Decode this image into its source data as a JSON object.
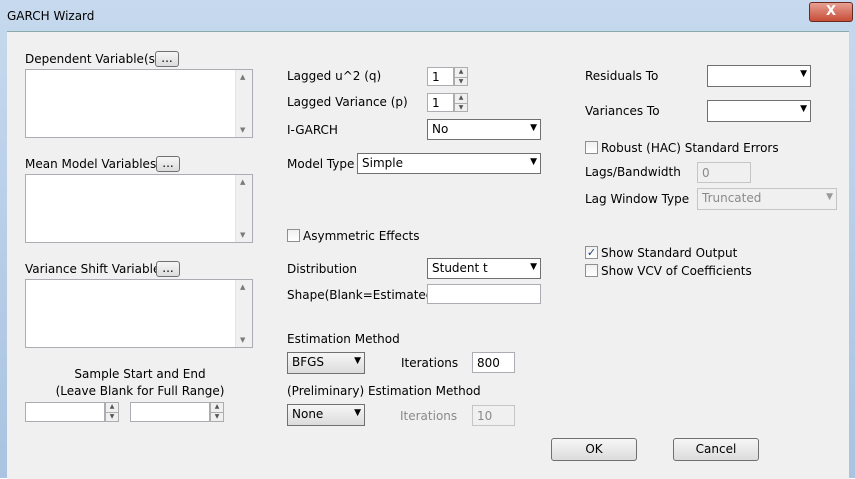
{
  "window": {
    "title": "GARCH Wizard",
    "close_glyph": "X"
  },
  "left": {
    "dependent_label": "Dependent Variable(s)",
    "mean_label": "Mean Model Variables",
    "variance_shift_label": "Variance Shift Variables",
    "browse_label": "...",
    "sample_line1": "Sample Start and End",
    "sample_line2": "(Leave Blank for Full Range)",
    "sample_start": "",
    "sample_end": ""
  },
  "middle": {
    "lagged_u2_label": "Lagged u^2 (q)",
    "lagged_u2_value": "1",
    "lagged_var_label": "Lagged Variance (p)",
    "lagged_var_value": "1",
    "igarch_label": "I-GARCH",
    "igarch_value": "No",
    "model_type_label": "Model Type",
    "model_type_value": "Simple",
    "asymmetric_label": "Asymmetric Effects",
    "asymmetric_checked": false,
    "distribution_label": "Distribution",
    "distribution_value": "Student t",
    "shape_label": "Shape(Blank=Estimated)",
    "shape_value": "",
    "estimation_label": "Estimation Method",
    "estimation_value": "BFGS",
    "iterations_label": "Iterations",
    "iterations_value": "800",
    "prelim_label": "(Preliminary) Estimation Method",
    "prelim_value": "None",
    "prelim_iter_label": "Iterations",
    "prelim_iter_value": "10"
  },
  "right": {
    "residuals_label": "Residuals To",
    "residuals_value": "",
    "variances_label": "Variances To",
    "variances_value": "",
    "robust_label": "Robust (HAC) Standard Errors",
    "robust_checked": false,
    "lags_label": "Lags/Bandwidth",
    "lags_value": "0",
    "lagwin_label": "Lag Window Type",
    "lagwin_value": "Truncated",
    "show_std_label": "Show Standard Output",
    "show_std_checked": true,
    "show_vcv_label": "Show VCV of Coefficients",
    "show_vcv_checked": false
  },
  "footer": {
    "ok_label": "OK",
    "cancel_label": "Cancel"
  },
  "icons": {
    "check_glyph": "✓",
    "arrow_down": "▼",
    "arrow_up": "▲"
  }
}
